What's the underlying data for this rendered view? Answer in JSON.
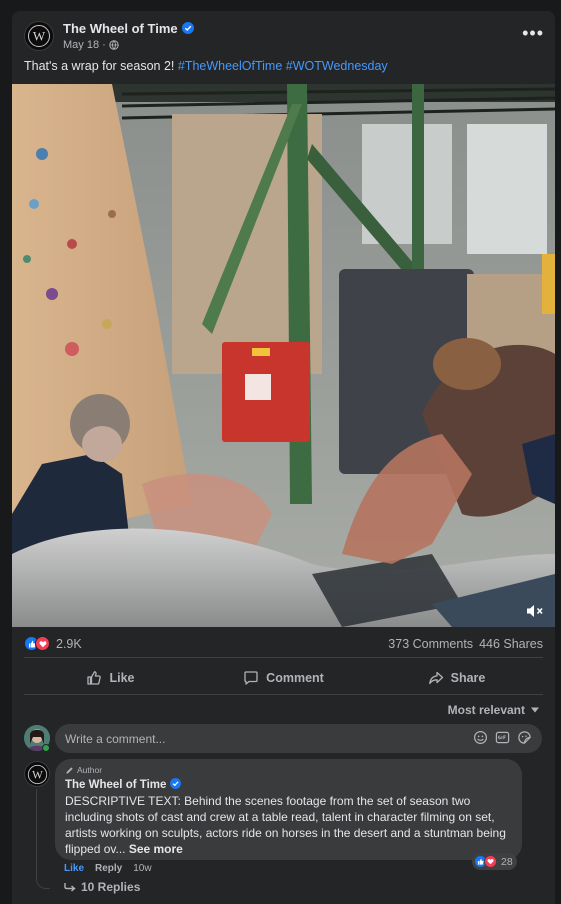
{
  "post": {
    "page_name": "The Wheel of Time",
    "date": "May 18",
    "caption_text": "That's a wrap for season 2! ",
    "hashtags": [
      "#TheWheelOfTime",
      "#WOTWednesday"
    ],
    "logo_text": "W"
  },
  "video": {
    "muted": true
  },
  "stats": {
    "reactions": "2.9K",
    "comments": "373 Comments",
    "shares": "446 Shares"
  },
  "actions": {
    "like": "Like",
    "comment": "Comment",
    "share": "Share"
  },
  "comments": {
    "sort_label": "Most relevant",
    "write_placeholder": "Write a comment...",
    "top": {
      "badge": "Author",
      "author": "The Wheel of Time",
      "text": "DESCRIPTIVE TEXT: Behind the scenes footage from the set of season two including shots of cast and crew at a table read, talent in character filming on set, artists working on sculpts, actors ride on horses in the desert and a stuntman being flipped ov... ",
      "see_more": "See more",
      "reaction_count": "28",
      "like": "Like",
      "reply": "Reply",
      "time": "10w",
      "replies": "10 Replies"
    }
  },
  "colors": {
    "background": "#18191a",
    "card": "#242526",
    "link": "#4599ff",
    "like_blue": "#1877f2",
    "love_red": "#f33e58"
  }
}
